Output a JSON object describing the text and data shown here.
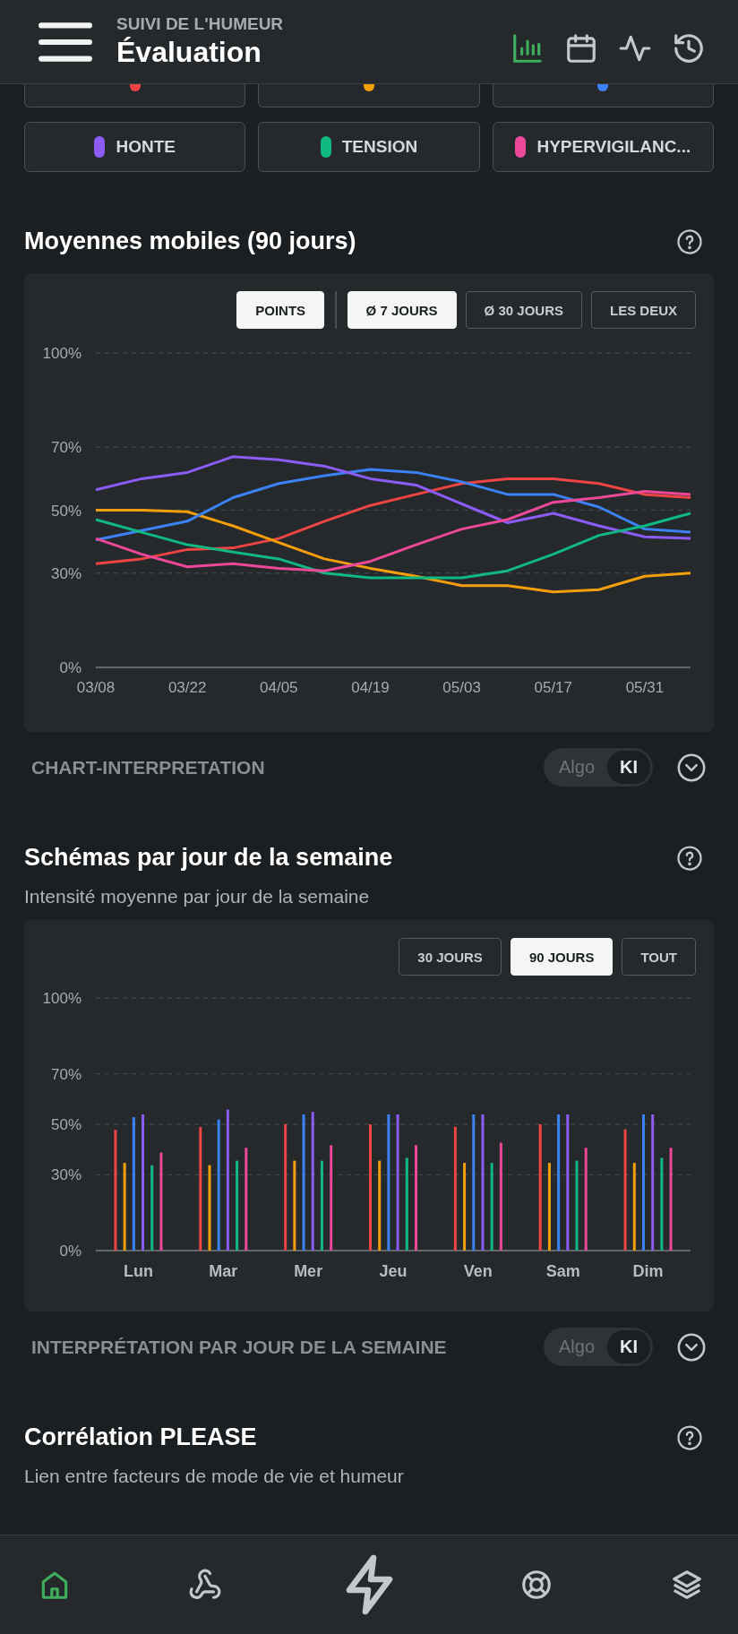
{
  "header": {
    "subtitle": "SUIVI DE L'HUMEUR",
    "title": "Évaluation",
    "tabs": [
      {
        "kind": "chart",
        "selected": true
      },
      {
        "kind": "calendar",
        "selected": false
      },
      {
        "kind": "activity",
        "selected": false
      },
      {
        "kind": "history",
        "selected": false
      }
    ]
  },
  "emotion_chips": [
    {
      "kind": "clipped",
      "color": "#ef4444"
    },
    {
      "kind": "clipped",
      "color": "#f59e0b"
    },
    {
      "kind": "clipped",
      "color": "#3b82f6"
    },
    {
      "kind": "full",
      "label": "HONTE",
      "color": "#8b5cf6"
    },
    {
      "kind": "full",
      "label": "TENSION",
      "color": "#10b981"
    },
    {
      "kind": "full",
      "label": "HYPERVIGILANC...",
      "color": "#ec4899"
    }
  ],
  "moving_averages": {
    "title": "Moyennes mobiles (90 jours)",
    "display_buttons": [
      {
        "label": "POINTS",
        "selected": true
      }
    ],
    "range_buttons": [
      {
        "label": "Ø 7 JOURS",
        "selected": true
      },
      {
        "label": "Ø 30 JOURS",
        "selected": false
      },
      {
        "label": "LES DEUX",
        "selected": false
      }
    ],
    "chart_data": {
      "type": "line",
      "categories": [
        "03/08",
        null,
        "03/22",
        null,
        "04/05",
        null,
        "04/19",
        null,
        "05/03",
        null,
        "05/17",
        null,
        "05/31",
        null
      ],
      "ylim": [
        0,
        100
      ],
      "grid": true,
      "yticks": [
        {
          "value": 0,
          "label": "0%"
        },
        {
          "value": 30,
          "label": "30%"
        },
        {
          "value": 50,
          "label": "50%"
        },
        {
          "value": 70,
          "label": "70%"
        },
        {
          "value": 100,
          "label": "100%"
        }
      ],
      "series": [
        {
          "color": "#ef4444",
          "values": [
            33,
            34.5,
            37.5,
            38,
            41,
            46.5,
            51.5,
            55,
            58.5,
            60,
            60,
            58.5,
            55,
            54
          ]
        },
        {
          "color": "#f59e0b",
          "values": [
            50,
            50,
            49.5,
            45,
            39.7,
            34.5,
            31.5,
            29,
            26,
            26,
            24,
            24.7,
            29,
            30
          ]
        },
        {
          "color": "#3b82f6",
          "values": [
            40.5,
            43.5,
            46.5,
            54,
            58.5,
            61,
            63,
            62,
            59,
            55,
            55,
            51,
            44,
            43
          ]
        },
        {
          "color": "#8b5cf6",
          "values": [
            56.5,
            60,
            62,
            67,
            66,
            64,
            60,
            58,
            52,
            46,
            49,
            45,
            41.5,
            41
          ]
        },
        {
          "color": "#10b981",
          "values": [
            47,
            43,
            39,
            36.7,
            34.5,
            30,
            28.5,
            28.5,
            28.5,
            30.7,
            36,
            42,
            45,
            49
          ]
        },
        {
          "color": "#ec4899",
          "values": [
            41,
            36,
            32,
            33,
            31.5,
            30.7,
            33.7,
            39,
            44,
            47,
            52.5,
            54,
            56,
            55
          ]
        }
      ]
    },
    "interpretation": {
      "label": "CHART-INTERPRETATION",
      "modes": [
        {
          "label": "Algo",
          "selected": false
        },
        {
          "label": "KI",
          "selected": true
        }
      ],
      "expanded": false
    }
  },
  "weekday_patterns": {
    "title": "Schémas par jour de la semaine",
    "subtitle": "Intensité moyenne par jour de la semaine",
    "range_buttons": [
      {
        "label": "30 JOURS",
        "selected": false
      },
      {
        "label": "90 JOURS",
        "selected": true
      },
      {
        "label": "TOUT",
        "selected": false
      }
    ],
    "chart_data": {
      "type": "bar",
      "categories": [
        "Lun",
        "Mar",
        "Mer",
        "Jeu",
        "Ven",
        "Sam",
        "Dim"
      ],
      "ylim": [
        0,
        100
      ],
      "grid": true,
      "yticks": [
        {
          "value": 0,
          "label": "0%"
        },
        {
          "value": 30,
          "label": "30%"
        },
        {
          "value": 50,
          "label": "50%"
        },
        {
          "value": 70,
          "label": "70%"
        },
        {
          "value": 100,
          "label": "100%"
        }
      ],
      "series": [
        {
          "color": "#ef4444",
          "values": [
            47.8,
            48.9,
            50,
            50,
            49,
            50,
            48
          ]
        },
        {
          "color": "#f59e0b",
          "values": [
            34.7,
            33.8,
            35.6,
            35.6,
            34.7,
            34.7,
            34.7
          ]
        },
        {
          "color": "#3b82f6",
          "values": [
            52.8,
            51.9,
            53.9,
            53.9,
            53.9,
            53.9,
            53.9
          ]
        },
        {
          "color": "#8b5cf6",
          "values": [
            53.9,
            55.8,
            54.9,
            53.9,
            53.9,
            53.9,
            53.9
          ]
        },
        {
          "color": "#10b981",
          "values": [
            33.8,
            35.6,
            35.6,
            36.7,
            34.7,
            35.6,
            36.7
          ]
        },
        {
          "color": "#ec4899",
          "values": [
            38.8,
            40.7,
            41.7,
            41.7,
            42.7,
            40.7,
            40.7
          ]
        }
      ]
    },
    "interpretation": {
      "label": "INTERPRÉTATION PAR JOUR DE LA SEMAINE",
      "modes": [
        {
          "label": "Algo",
          "selected": false
        },
        {
          "label": "KI",
          "selected": true
        }
      ],
      "expanded": false
    }
  },
  "correlation": {
    "title": "Corrélation PLEASE",
    "subtitle": "Lien entre facteurs de mode de vie et humeur"
  },
  "bottom_nav": [
    {
      "kind": "home",
      "selected": true
    },
    {
      "kind": "webhook",
      "selected": false
    },
    {
      "kind": "bolt",
      "selected": false
    },
    {
      "kind": "lifebuoy",
      "selected": false
    },
    {
      "kind": "layers",
      "selected": false
    }
  ]
}
